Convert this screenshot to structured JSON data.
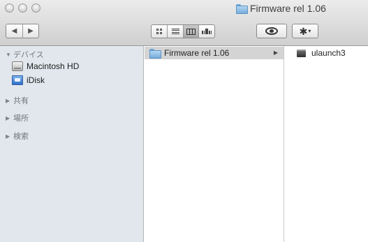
{
  "window": {
    "title": "Firmware rel 1.06"
  },
  "toolbar": {
    "nav_back_glyph": "◀",
    "nav_forward_glyph": "▶",
    "view_buttons": [
      "icon-view",
      "list-view",
      "column-view",
      "coverflow-view"
    ],
    "active_view": "column-view",
    "quicklook_icon": "eye-icon",
    "action_icon": "gear-icon",
    "action_caret": "▾"
  },
  "sidebar": {
    "sections": [
      {
        "label": "デバイス",
        "expanded": true,
        "expanded_glyph": "▼"
      },
      {
        "label": "共有",
        "expanded": false,
        "collapsed_glyph": "▶"
      },
      {
        "label": "場所",
        "expanded": false,
        "collapsed_glyph": "▶"
      },
      {
        "label": "検索",
        "expanded": false,
        "collapsed_glyph": "▶"
      }
    ],
    "devices": [
      {
        "label": "Macintosh HD",
        "icon": "hard-drive-icon"
      },
      {
        "label": "iDisk",
        "icon": "idisk-icon"
      }
    ]
  },
  "columns": [
    {
      "items": [
        {
          "label": "Firmware rel 1.06",
          "icon": "folder-icon",
          "selected": true,
          "has_children": true,
          "expand_glyph": "▶"
        }
      ]
    },
    {
      "items": [
        {
          "label": "ulaunch3",
          "icon": "executable-icon",
          "selected": false
        }
      ]
    }
  ],
  "colors": {
    "sidebar_bg": "#e2e7ed",
    "selection_bg": "#d4d4d4",
    "section_text": "#6f7680"
  }
}
